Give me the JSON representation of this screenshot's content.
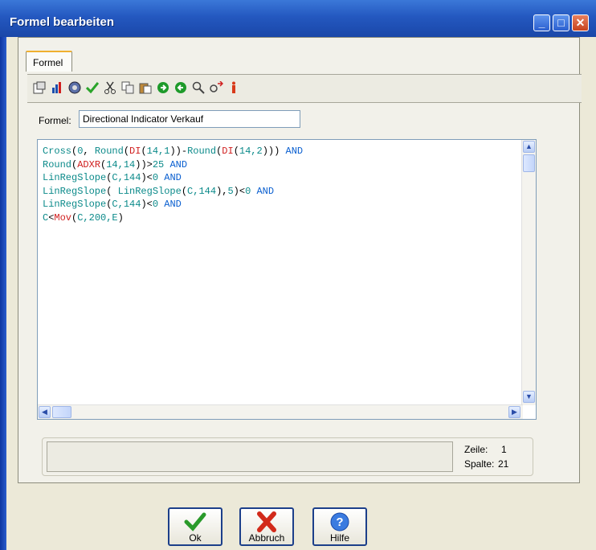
{
  "window": {
    "title": "Formel bearbeiten",
    "buttons": {
      "minimize": "_",
      "maximize": "□",
      "close": "✕"
    }
  },
  "tab": {
    "label": "Formel"
  },
  "toolbar": {
    "icons": [
      "properties-icon",
      "chart-icon",
      "globe-icon",
      "check-icon",
      "cut-icon",
      "copy-icon",
      "paste-icon",
      "forward-icon",
      "back-icon",
      "search-icon",
      "replace-icon",
      "info-icon"
    ]
  },
  "form": {
    "formel_label": "Formel:",
    "formel_value": "Directional Indicator Verkauf"
  },
  "editor": {
    "lines": [
      "Cross(0, Round(DI(14,1))-Round(DI(14,2))) AND",
      "Round(ADXR(14,14))>25 AND",
      "LinRegSlope(C,144)<0 AND",
      "LinRegSlope( LinRegSlope(C,144),5)<0 AND",
      "LinRegSlope(C,144)<0 AND",
      "C<Mov(C,200,E)"
    ]
  },
  "status": {
    "zeile_label": "Zeile:",
    "zeile_value": "1",
    "spalte_label": "Spalte:",
    "spalte_value": "21"
  },
  "buttons": {
    "ok": "Ok",
    "abbruch": "Abbruch",
    "hilfe": "Hilfe"
  },
  "colors": {
    "titlebar": "#2458c0",
    "function": "#0b8a8a",
    "keyword": "#0a5fd0",
    "indicator": "#d02020"
  }
}
